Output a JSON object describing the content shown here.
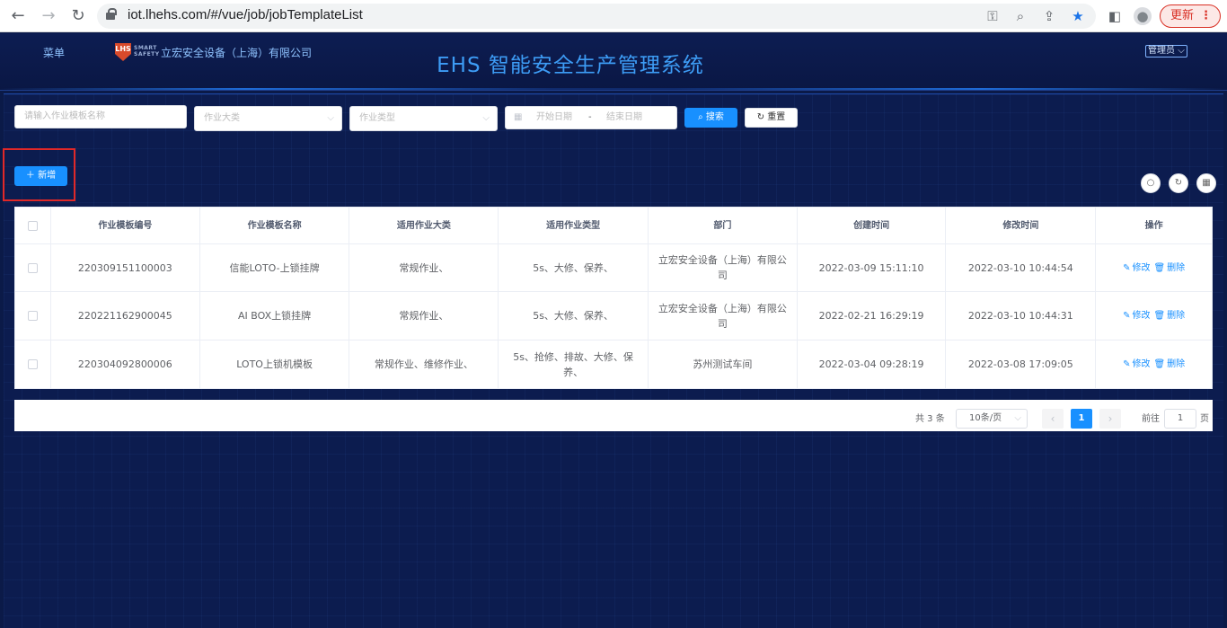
{
  "browser": {
    "url": "iot.lhehs.com/#/vue/job/jobTemplateList",
    "update_label": "更新"
  },
  "header": {
    "menu_label": "菜单",
    "company": "立宏安全设备（上海）有限公司",
    "title": "EHS 智能安全生产管理系统",
    "user_role": "管理员"
  },
  "filters": {
    "name_placeholder": "请输入作业模板名称",
    "category_placeholder": "作业大类",
    "type_placeholder": "作业类型",
    "start_date_placeholder": "开始日期",
    "date_separator": "-",
    "end_date_placeholder": "结束日期",
    "search_label": "搜索",
    "reset_label": "重置"
  },
  "toolbar": {
    "add_label": "新增"
  },
  "table": {
    "columns": [
      "作业模板编号",
      "作业模板名称",
      "适用作业大类",
      "适用作业类型",
      "部门",
      "创建时间",
      "修改时间",
      "操作"
    ],
    "edit_label": "修改",
    "delete_label": "删除",
    "rows": [
      {
        "code": "220309151100003",
        "name": "信能LOTO-上锁挂牌",
        "category": "常规作业、",
        "type": "5s、大修、保养、",
        "dept": "立宏安全设备（上海）有限公司",
        "created": "2022-03-09 15:11:10",
        "modified": "2022-03-10 10:44:54"
      },
      {
        "code": "220221162900045",
        "name": "AI BOX上锁挂牌",
        "category": "常规作业、",
        "type": "5s、大修、保养、",
        "dept": "立宏安全设备（上海）有限公司",
        "created": "2022-02-21 16:29:19",
        "modified": "2022-03-10 10:44:31"
      },
      {
        "code": "220304092800006",
        "name": "LOTO上锁机模板",
        "category": "常规作业、维修作业、",
        "type": "5s、抢修、排故、大修、保养、",
        "dept": "苏州测试车间",
        "created": "2022-03-04 09:28:19",
        "modified": "2022-03-08 17:09:05"
      }
    ]
  },
  "pagination": {
    "total": "共 3 条",
    "page_size": "10条/页",
    "current_page": "1",
    "goto_prefix": "前往",
    "goto_value": "1",
    "goto_suffix": "页"
  },
  "colors": {
    "primary": "#1890ff",
    "background": "#0b1a48",
    "title": "#3d9cf5",
    "highlight": "#e02828"
  }
}
